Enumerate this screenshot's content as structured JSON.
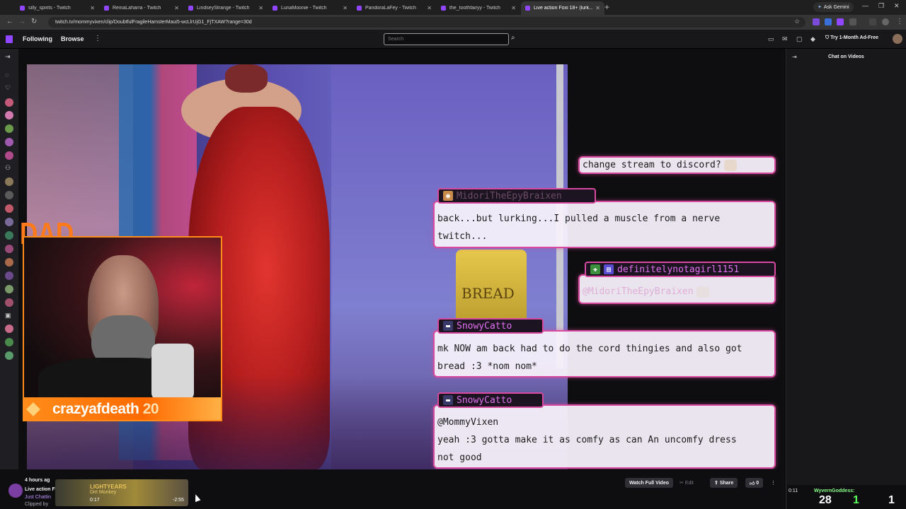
{
  "browser": {
    "tabs": [
      {
        "title": "silly_spirits - Twitch",
        "active": false
      },
      {
        "title": "ReinaLaharra - Twitch",
        "active": false
      },
      {
        "title": "LindseyStrange - Twitch",
        "active": false
      },
      {
        "title": "LunaMoonie - Twitch",
        "active": false
      },
      {
        "title": "PandoraLaFey - Twitch",
        "active": false
      },
      {
        "title": "the_toothfairyy - Twitch",
        "active": false
      },
      {
        "title": "Live action Foxi 18+ (lurk...",
        "active": true
      }
    ],
    "new_tab": "+",
    "ask_gemini": "Ask Gemini",
    "url": "twitch.tv/mommyvixen/clip/DoubtfulFragileHamsterMaui5-wcLlrUjG1_FjTXAW?range=30d"
  },
  "topnav": {
    "following": "Following",
    "browse": "Browse",
    "search_placeholder": "Search",
    "ad_free": "Try 1-Month Ad-Free"
  },
  "overlay": {
    "webcam_name": "crazyafdeath",
    "webcam_number": "20",
    "dad_text": "DAD",
    "bread_label": "BREAD"
  },
  "chat_overlay": {
    "bubble1": {
      "text": "change stream to discord?"
    },
    "bubble2": {
      "user": "MidoriTheEpyBraixen",
      "line1": "back...but lurking...I pulled a muscle from a nerve",
      "line2": "twitch..."
    },
    "bubble3": {
      "user": "definitelynotagirl1151",
      "mention": "@MidoriTheEpyBraixen"
    },
    "bubble4": {
      "user": "SnowyCatto",
      "line1": "mk NOW am back had to do the cord thingies and also got",
      "line2": "bread :3 *nom nom*"
    },
    "bubble5": {
      "user": "SnowyCatto",
      "mention": "@MommyVixen",
      "line1": "yeah :3 gotta make it as comfy as can An uncomfy dress",
      "line2": "not good"
    }
  },
  "clip_info": {
    "time_ago": "4 hours ag",
    "title": "Live action F",
    "category": "Just Chattin",
    "clipped_by": "Clipped by",
    "thumb_title": "LIGHTYEARS",
    "thumb_sub": "Dirt Monkey",
    "thumb_left": "0:17",
    "thumb_right": "-2:55"
  },
  "actions": {
    "watch_full": "Watch Full Video",
    "edit": "Edit",
    "share": "Share",
    "likes": "0"
  },
  "chat_panel": {
    "title": "Chat on Videos"
  },
  "bottom_right": {
    "time": "0:11",
    "user": "WyvernGoddess:",
    "count1": "28",
    "count2": "1",
    "count3": "1"
  }
}
